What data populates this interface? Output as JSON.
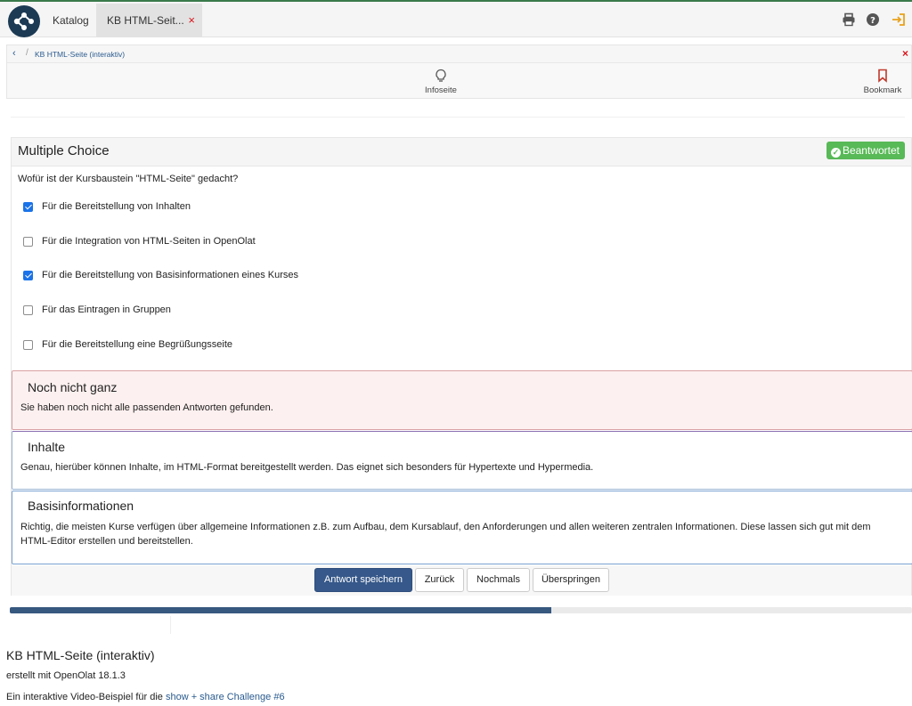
{
  "header": {
    "katalog_label": "Katalog",
    "active_tab_label": "KB HTML-Seit...",
    "tab_close": "×",
    "icons": [
      "print-icon",
      "help-icon",
      "logout-icon"
    ]
  },
  "toolbar": {
    "breadcrumb": "KB HTML-Seite (interaktiv)",
    "close": "×",
    "infoseite_label": "Infoseite",
    "bookmark_label": "Bookmark"
  },
  "question": {
    "type_title": "Multiple Choice",
    "status_badge": "Beantwortet",
    "prompt": "Wofür ist der Kursbaustein \"HTML-Seite\" gedacht?",
    "options": [
      {
        "label": "Für die Bereitstellung von Inhalten",
        "checked": true
      },
      {
        "label": "Für die Integration von HTML-Seiten in OpenOlat",
        "checked": false
      },
      {
        "label": "Für die Bereitstellung von Basisinformationen eines Kurses",
        "checked": true
      },
      {
        "label": "Für das Eintragen in Gruppen",
        "checked": false
      },
      {
        "label": "Für die Bereitstellung eine Begrüßungsseite",
        "checked": false
      }
    ]
  },
  "feedback": [
    {
      "title": "Noch nicht ganz",
      "text": "Sie haben noch nicht alle passenden Antworten gefunden."
    },
    {
      "title": "Inhalte",
      "text": "Genau, hierüber können Inhalte, im HTML-Format bereitgestellt werden. Das eignet sich besonders für Hypertexte und Hypermedia."
    },
    {
      "title": "Basisinformationen",
      "text": "Richtig, die meisten Kurse verfügen über allgemeine Informationen z.B. zum Aufbau, dem Kursablauf, den Anforderungen und allen weiteren zentralen Informationen. Diese lassen sich gut mit dem HTML-Editor erstellen und bereitstellen."
    }
  ],
  "buttons": {
    "save": "Antwort speichern",
    "back": "Zurück",
    "again": "Nochmals",
    "skip": "Überspringen"
  },
  "progress": {
    "fraction": 0.6
  },
  "footer": {
    "title": "KB HTML-Seite (interaktiv)",
    "created_with": "erstellt mit OpenOlat 18.1.3",
    "line_prefix": "Ein interaktive Video-Beispiel für die ",
    "link_text": "show + share Challenge #6"
  },
  "colors": {
    "brand_dark": "#1c3a54",
    "primary_button": "#36588a",
    "badge_green": "#58b957",
    "close_red": "#d9141b",
    "checkbox_blue": "#1a73e8"
  }
}
